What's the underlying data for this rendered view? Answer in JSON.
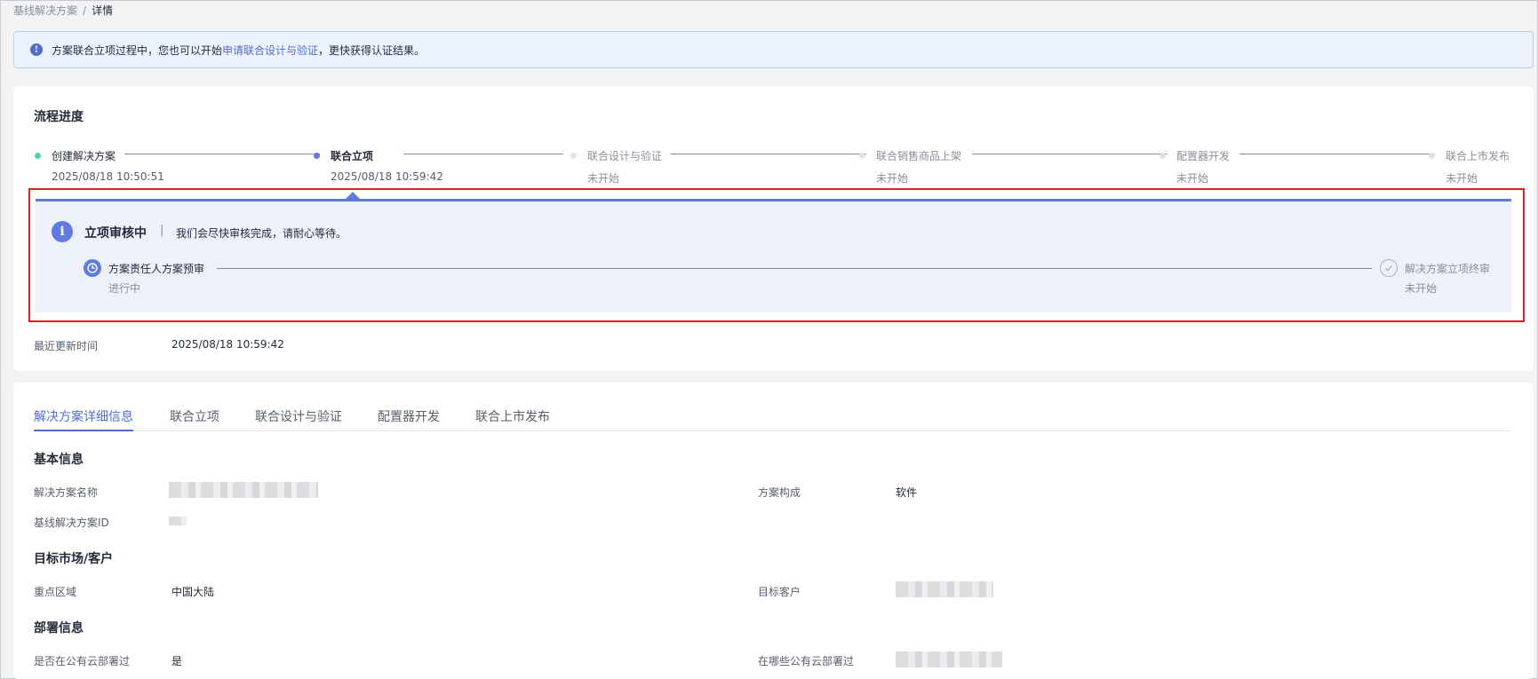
{
  "breadcrumb": {
    "parent": "基线解决方案",
    "separator": "/",
    "current": "详情"
  },
  "notice": {
    "text_before": "方案联合立项过程中，您也可以开始",
    "link": "申请联合设计与验证",
    "text_after": "，更快获得认证结果。",
    "icon": "info-icon"
  },
  "progress": {
    "title": "流程进度",
    "steps": [
      {
        "name": "创建解决方案",
        "time": "2025/08/18 10:50:51",
        "status": "done",
        "color": "#50d4ab"
      },
      {
        "name": "联合立项",
        "time": "2025/08/18 10:59:42",
        "status": "active",
        "color": "#5e7ce0"
      },
      {
        "name": "联合设计与验证",
        "time": "未开始",
        "status": "pending",
        "color": "#dfe1e6"
      },
      {
        "name": "联合销售商品上架",
        "time": "未开始",
        "status": "pending",
        "color": "#dfe1e6"
      },
      {
        "name": "配置器开发",
        "time": "未开始",
        "status": "pending",
        "color": "#dfe1e6"
      },
      {
        "name": "联合上市发布",
        "time": "未开始",
        "status": "pending",
        "color": "#dfe1e6"
      }
    ],
    "review": {
      "title": "立项审核中",
      "separator": "|",
      "desc": "我们会尽快审核完成，请耐心等待。",
      "sub_steps": [
        {
          "name": "方案责任人方案预审",
          "status": "进行中",
          "icon": "clock-icon"
        },
        {
          "name": "解决方案立项终审",
          "status": "未开始",
          "icon": "check-circle-icon"
        }
      ]
    },
    "last_update_label": "最近更新时间",
    "last_update_value": "2025/08/18 10:59:42"
  },
  "tabs": [
    {
      "label": "解决方案详细信息",
      "active": true
    },
    {
      "label": "联合立项",
      "active": false
    },
    {
      "label": "联合设计与验证",
      "active": false
    },
    {
      "label": "配置器开发",
      "active": false
    },
    {
      "label": "联合上市发布",
      "active": false
    }
  ],
  "details": {
    "basic": {
      "title": "基本信息",
      "name_label": "解决方案名称",
      "composition_label": "方案构成",
      "composition_value": "软件",
      "id_label": "基线解决方案ID"
    },
    "market": {
      "title": "目标市场/客户",
      "region_label": "重点区域",
      "region_value": "中国大陆",
      "customer_label": "目标客户"
    },
    "deploy": {
      "title": "部署信息",
      "public_cloud_label": "是否在公有云部署过",
      "public_cloud_value": "是",
      "which_cloud_label": "在哪些公有云部署过"
    }
  }
}
